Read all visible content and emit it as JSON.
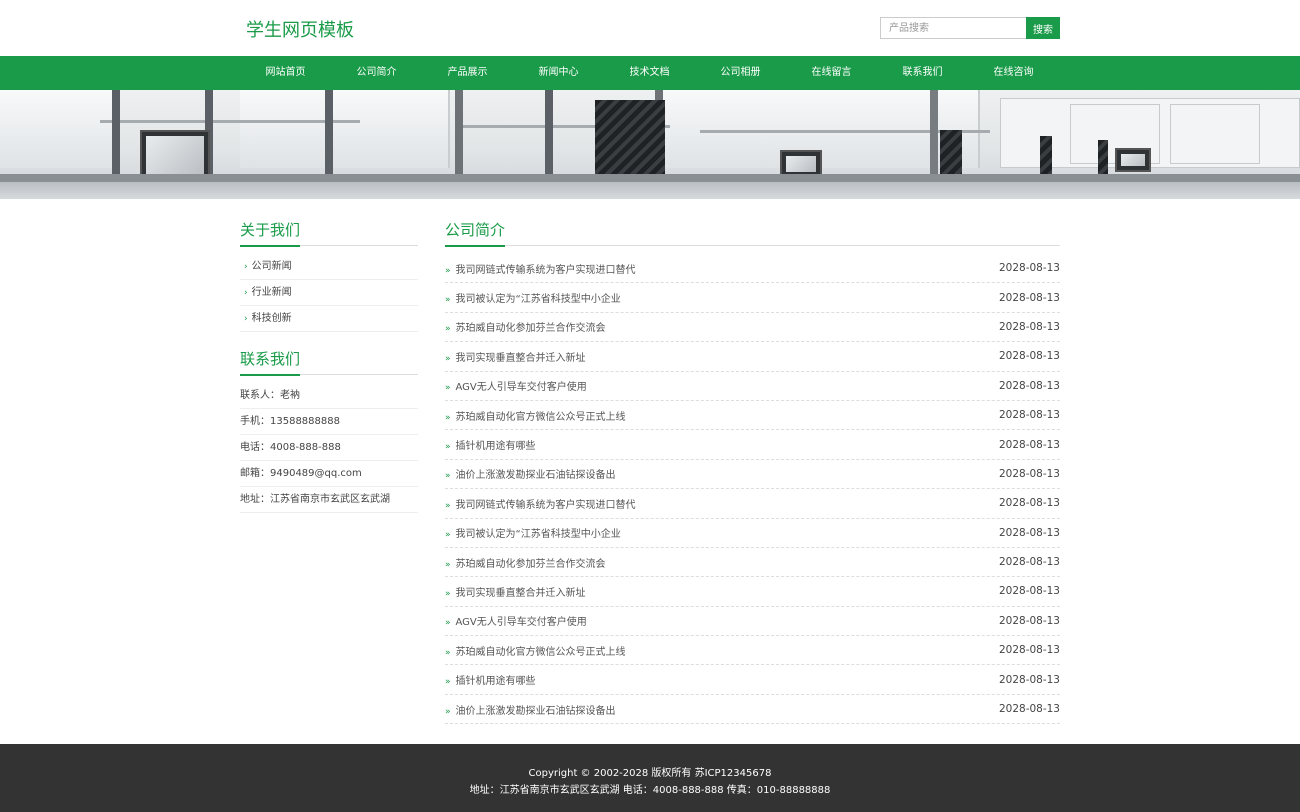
{
  "header": {
    "logo": "学生网页模板",
    "search_placeholder": "产品搜索",
    "search_button": "搜索"
  },
  "nav": {
    "items": [
      "网站首页",
      "公司简介",
      "产品展示",
      "新闻中心",
      "技术文档",
      "公司相册",
      "在线留言",
      "联系我们",
      "在线咨询"
    ]
  },
  "sidebar": {
    "about_title": "关于我们",
    "menu": [
      "公司新闻",
      "行业新闻",
      "科技创新"
    ],
    "contact_title": "联系我们",
    "contact": [
      "联系人：老衲",
      "手机：13588888888",
      "电话：4008-888-888",
      "邮箱：9490489@qq.com",
      "地址：江苏省南京市玄武区玄武湖"
    ]
  },
  "content": {
    "title": "公司简介",
    "news": [
      {
        "title": "我司网链式传输系统为客户实现进口替代",
        "date": "2028-08-13"
      },
      {
        "title": "我司被认定为“江苏省科技型中小企业",
        "date": "2028-08-13"
      },
      {
        "title": "苏珀威自动化参加芬兰合作交流会",
        "date": "2028-08-13"
      },
      {
        "title": "我司实现垂直整合并迁入新址",
        "date": "2028-08-13"
      },
      {
        "title": "AGV无人引导车交付客户使用",
        "date": "2028-08-13"
      },
      {
        "title": "苏珀威自动化官方微信公众号正式上线",
        "date": "2028-08-13"
      },
      {
        "title": "插针机用途有哪些",
        "date": "2028-08-13"
      },
      {
        "title": "油价上涨激发勘探业石油钻探设备出",
        "date": "2028-08-13"
      },
      {
        "title": "我司网链式传输系统为客户实现进口替代",
        "date": "2028-08-13"
      },
      {
        "title": "我司被认定为“江苏省科技型中小企业",
        "date": "2028-08-13"
      },
      {
        "title": "苏珀威自动化参加芬兰合作交流会",
        "date": "2028-08-13"
      },
      {
        "title": "我司实现垂直整合并迁入新址",
        "date": "2028-08-13"
      },
      {
        "title": "AGV无人引导车交付客户使用",
        "date": "2028-08-13"
      },
      {
        "title": "苏珀威自动化官方微信公众号正式上线",
        "date": "2028-08-13"
      },
      {
        "title": "插针机用途有哪些",
        "date": "2028-08-13"
      },
      {
        "title": "油价上涨激发勘探业石油钻探设备出",
        "date": "2028-08-13"
      }
    ]
  },
  "footer": {
    "line1": "Copyright © 2002-2028 版权所有 苏ICP12345678",
    "line2": "地址：江苏省南京市玄武区玄武湖 电话：4008-888-888 传真：010-88888888"
  },
  "colors": {
    "brand": "#1a9b49",
    "footer_bg": "#333333"
  }
}
